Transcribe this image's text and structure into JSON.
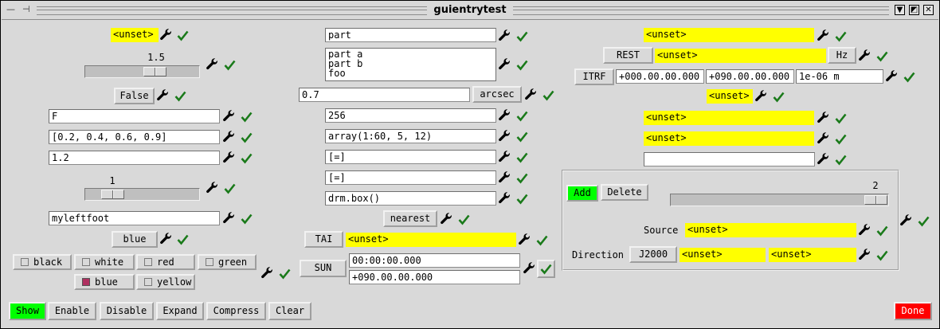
{
  "window": {
    "title": "guientrytest"
  },
  "colors": {
    "unset_bg": "#ffff00",
    "show_bg": "#00ff00",
    "add_bg": "#00ff00",
    "done_bg": "#ff0000",
    "check": "#1a7a1a"
  },
  "icons": {
    "tool": "wrench-icon",
    "ok": "check-mark-icon"
  },
  "left": {
    "unset1": "<unset>",
    "scale1": {
      "value": "1.5",
      "position": 0.55
    },
    "bool_label": "False",
    "entry_f": "F",
    "entry_vector": "[0.2, 0.4, 0.6, 0.9]",
    "entry_num": "1.2",
    "scale2": {
      "value": "1",
      "position": 0.18
    },
    "entry_foot": "myleftfoot",
    "color_button": "blue",
    "toggles": [
      {
        "label": "black",
        "on": false
      },
      {
        "label": "white",
        "on": false
      },
      {
        "label": "red",
        "on": false
      },
      {
        "label": "green",
        "on": false
      },
      {
        "label": "blue",
        "on": true
      },
      {
        "label": "yellow",
        "on": false
      }
    ]
  },
  "middle": {
    "entry_part": "part",
    "list_text": "part a\npart b\nfoo",
    "quantity_value": "0.7",
    "quantity_unit": "arcsec",
    "entry_256": "256",
    "entry_array": "array(1:60, 5, 12)",
    "entry_eq1": "[=]",
    "entry_eq2": "[=]",
    "entry_drm": "drm.box()",
    "nearest_label": "nearest",
    "tai_label": "TAI",
    "tai_value": "<unset>",
    "sun_label": "SUN",
    "sun_time": "00:00:00.000",
    "sun_dec": "+090.00.00.000"
  },
  "right": {
    "unset_top": "<unset>",
    "rest_label": "REST",
    "rest_value": "<unset>",
    "hz_label": "Hz",
    "itrf_label": "ITRF",
    "itrf_lon": "+000.00.00.000",
    "itrf_lat": "+090.00.00.000",
    "itrf_height": "1e-06 m",
    "unset_center": "<unset>",
    "unset_a": "<unset>",
    "unset_b": "<unset>",
    "entry_empty": "",
    "add_label": "Add",
    "delete_label": "Delete",
    "scale_value": "2",
    "scale_position": 0.95,
    "source_label": "Source",
    "source_value": "<unset>",
    "direction_label": "Direction",
    "direction_frame": "J2000",
    "dir_lon": "<unset>",
    "dir_lat": "<unset>"
  },
  "bottom": {
    "show": "Show",
    "enable": "Enable",
    "disable": "Disable",
    "expand": "Expand",
    "compress": "Compress",
    "clear": "Clear",
    "done": "Done"
  }
}
